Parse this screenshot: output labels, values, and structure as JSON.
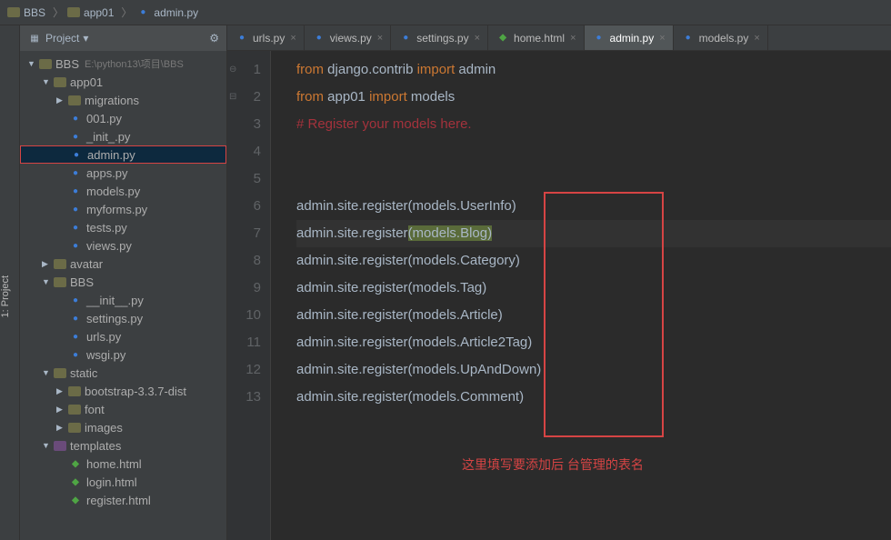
{
  "breadcrumb": {
    "p1": "BBS",
    "p2": "app01",
    "p3": "admin.py"
  },
  "project_header": {
    "label": "Project"
  },
  "side_tab": "1: Project",
  "tree": [
    {
      "depth": 0,
      "arrow": "▼",
      "icon": "folder",
      "name": "BBS",
      "path": "E:\\python13\\项目\\BBS"
    },
    {
      "depth": 1,
      "arrow": "▼",
      "icon": "folder",
      "name": "app01"
    },
    {
      "depth": 2,
      "arrow": "▶",
      "icon": "folder",
      "name": "migrations"
    },
    {
      "depth": 2,
      "arrow": "",
      "icon": "py",
      "name": "001.py"
    },
    {
      "depth": 2,
      "arrow": "",
      "icon": "py",
      "name": "_init_.py"
    },
    {
      "depth": 2,
      "arrow": "",
      "icon": "py",
      "name": "admin.py",
      "selected": true,
      "boxed": true
    },
    {
      "depth": 2,
      "arrow": "",
      "icon": "py",
      "name": "apps.py"
    },
    {
      "depth": 2,
      "arrow": "",
      "icon": "py",
      "name": "models.py"
    },
    {
      "depth": 2,
      "arrow": "",
      "icon": "py",
      "name": "myforms.py"
    },
    {
      "depth": 2,
      "arrow": "",
      "icon": "py",
      "name": "tests.py"
    },
    {
      "depth": 2,
      "arrow": "",
      "icon": "py",
      "name": "views.py"
    },
    {
      "depth": 1,
      "arrow": "▶",
      "icon": "folder",
      "name": "avatar"
    },
    {
      "depth": 1,
      "arrow": "▼",
      "icon": "folder",
      "name": "BBS"
    },
    {
      "depth": 2,
      "arrow": "",
      "icon": "py",
      "name": "__init__.py"
    },
    {
      "depth": 2,
      "arrow": "",
      "icon": "py",
      "name": "settings.py"
    },
    {
      "depth": 2,
      "arrow": "",
      "icon": "py",
      "name": "urls.py"
    },
    {
      "depth": 2,
      "arrow": "",
      "icon": "py",
      "name": "wsgi.py"
    },
    {
      "depth": 1,
      "arrow": "▼",
      "icon": "folder",
      "name": "static"
    },
    {
      "depth": 2,
      "arrow": "▶",
      "icon": "folder",
      "name": "bootstrap-3.3.7-dist"
    },
    {
      "depth": 2,
      "arrow": "▶",
      "icon": "folder",
      "name": "font"
    },
    {
      "depth": 2,
      "arrow": "▶",
      "icon": "folder",
      "name": "images"
    },
    {
      "depth": 1,
      "arrow": "▼",
      "icon": "tfolder",
      "name": "templates"
    },
    {
      "depth": 2,
      "arrow": "",
      "icon": "html",
      "name": "home.html"
    },
    {
      "depth": 2,
      "arrow": "",
      "icon": "html",
      "name": "login.html"
    },
    {
      "depth": 2,
      "arrow": "",
      "icon": "html",
      "name": "register.html"
    }
  ],
  "tabs": [
    {
      "name": "urls.py",
      "icon": "py"
    },
    {
      "name": "views.py",
      "icon": "py"
    },
    {
      "name": "settings.py",
      "icon": "py"
    },
    {
      "name": "home.html",
      "icon": "html"
    },
    {
      "name": "admin.py",
      "icon": "py",
      "active": true
    },
    {
      "name": "models.py",
      "icon": "py"
    }
  ],
  "code_lines": [
    {
      "n": 1,
      "t": [
        [
          "kw",
          "from "
        ],
        [
          "norm",
          "django.contrib "
        ],
        [
          "kw",
          "import "
        ],
        [
          "norm",
          "admin"
        ]
      ]
    },
    {
      "n": 2,
      "t": [
        [
          "kw",
          "from "
        ],
        [
          "norm",
          "app01 "
        ],
        [
          "kw",
          "import "
        ],
        [
          "norm",
          "models"
        ]
      ]
    },
    {
      "n": 3,
      "t": [
        [
          "comr",
          "# Register your models here."
        ]
      ]
    },
    {
      "n": 4,
      "t": []
    },
    {
      "n": 5,
      "t": []
    },
    {
      "n": 6,
      "t": [
        [
          "norm",
          "admin.site.register(models.UserInfo)"
        ]
      ]
    },
    {
      "n": 7,
      "hl": true,
      "t": [
        [
          "norm",
          "admin.site.register"
        ],
        [
          "sel",
          "(models.Blog)"
        ]
      ]
    },
    {
      "n": 8,
      "t": [
        [
          "norm",
          "admin.site.register(models.Category)"
        ]
      ]
    },
    {
      "n": 9,
      "t": [
        [
          "norm",
          "admin.site.register(models.Tag)"
        ]
      ]
    },
    {
      "n": 10,
      "t": [
        [
          "norm",
          "admin.site.register(models.Article)"
        ]
      ]
    },
    {
      "n": 11,
      "t": [
        [
          "norm",
          "admin.site.register(models.Article2Tag)"
        ]
      ]
    },
    {
      "n": 12,
      "t": [
        [
          "norm",
          "admin.site.register(models.UpAndDown)"
        ]
      ]
    },
    {
      "n": 13,
      "t": [
        [
          "norm",
          "admin.site.register(models.Comment)"
        ]
      ]
    }
  ],
  "annotation": "这里填写要添加后 台管理的表名"
}
